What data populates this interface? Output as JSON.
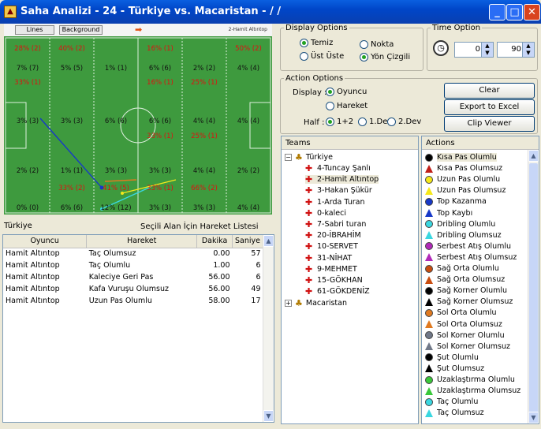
{
  "window": {
    "title": "Saha Analizi - 24 - Türkiye vs. Macaristan -  / /",
    "icon": "app-icon"
  },
  "colors": {
    "pitch": "#3e9a3e",
    "red_zone_text": "#e01010",
    "accent": "#0046c8"
  },
  "pitch": {
    "lines_label": "Lines",
    "background_label": "Background",
    "player_caption": "2-Hamit Altıntop",
    "zones": [
      [
        "28% (2)",
        "40% (2)",
        "",
        "16% (1)",
        "",
        "50% (2)"
      ],
      [
        "7% (7)",
        "5% (5)",
        "1% (1)",
        "6% (6)",
        "2% (2)",
        "4% (4)"
      ],
      [
        "33% (1)",
        "",
        "",
        "16% (1)",
        "25% (1)",
        ""
      ],
      [
        "3% (3)",
        "3% (3)",
        "6% (6)",
        "6% (6)",
        "4% (4)",
        "4% (4)"
      ],
      [
        "",
        "",
        "",
        "33% (1)",
        "25% (1)",
        ""
      ],
      [
        "2% (2)",
        "1% (1)",
        "3% (3)",
        "3% (3)",
        "4% (4)",
        "2% (2)"
      ],
      [
        "",
        "33% (2)",
        "41% (5)",
        "33% (1)",
        "66% (2)",
        ""
      ],
      [
        "0% (0)",
        "6% (6)",
        "12% (12)",
        "3% (3)",
        "3% (3)",
        "4% (4)"
      ]
    ],
    "red_rows": [
      0,
      2,
      4,
      6
    ]
  },
  "list": {
    "team": "Türkiye",
    "heading": "Seçili Alan İçin Hareket Listesi",
    "columns": [
      "Oyuncu",
      "Hareket",
      "Dakika",
      "Saniye"
    ],
    "rows": [
      [
        "Hamit Altıntop",
        "Taç Olumsuz",
        "0.00",
        "57"
      ],
      [
        "Hamit Altıntop",
        "Taç Olumlu",
        "1.00",
        "6"
      ],
      [
        "Hamit Altıntop",
        "Kaleciye Geri Pas",
        "56.00",
        "6"
      ],
      [
        "Hamit Altıntop",
        "Kafa Vuruşu Olumsuz",
        "56.00",
        "49"
      ],
      [
        "Hamit Altıntop",
        "Uzun Pas Olumlu",
        "58.00",
        "17"
      ]
    ]
  },
  "display_options": {
    "legend": "Display Options",
    "temiz": "Temiz",
    "nokta": "Nokta",
    "ust_uste": "Üst Üste",
    "yon_cizgili": "Yön Çizgili"
  },
  "time_option": {
    "legend": "Time Option",
    "from": "0",
    "to": "90"
  },
  "action_options": {
    "legend": "Action Options",
    "display_label": "Display :",
    "oyuncu": "Oyuncu",
    "hareket": "Hareket",
    "half_label": "Half :",
    "half1": "1+2",
    "half2": "1.Dev",
    "half3": "2.Dev",
    "clear": "Clear",
    "export": "Export to Excel",
    "clip": "Clip Viewer"
  },
  "teams": {
    "header": "Teams",
    "team1": "Türkiye",
    "team2": "Macaristan",
    "players": [
      "4-Tuncay Şanlı",
      "2-Hamit Altıntop",
      "3-Hakan Şükür",
      "1-Arda Turan",
      "0-kaleci",
      "7-Sabri turan",
      "20-İBRAHİM",
      "10-SERVET",
      "31-NİHAT",
      "9-MEHMET",
      "15-GÖKHAN",
      "61-GÖKDENİZ"
    ]
  },
  "actions": {
    "header": "Actions",
    "items": [
      {
        "label": "Kısa Pas Olumlu",
        "shape": "circle",
        "color": "#000000"
      },
      {
        "label": "Kısa Pas Olumsuz",
        "shape": "tri",
        "color": "#c0201a"
      },
      {
        "label": "Uzun Pas Olumlu",
        "shape": "circle",
        "color": "#f5e81a"
      },
      {
        "label": "Uzun Pas Olumsuz",
        "shape": "tri",
        "color": "#f5e81a"
      },
      {
        "label": "Top Kazanma",
        "shape": "circle",
        "color": "#1638c8"
      },
      {
        "label": "Top Kaybı",
        "shape": "tri",
        "color": "#1638c8"
      },
      {
        "label": "Dribling Olumlu",
        "shape": "circle",
        "color": "#3ad7e0"
      },
      {
        "label": "Dribling Olumsuz",
        "shape": "tri",
        "color": "#3ad7e0"
      },
      {
        "label": "Serbest Atış Olumlu",
        "shape": "circle",
        "color": "#b02ab8"
      },
      {
        "label": "Serbest Atış Olumsuz",
        "shape": "tri",
        "color": "#b02ab8"
      },
      {
        "label": "Sağ Orta Olumlu",
        "shape": "circle",
        "color": "#c84d10"
      },
      {
        "label": "Sağ Orta Olumsuz",
        "shape": "tri",
        "color": "#c84d10"
      },
      {
        "label": "Sağ Korner Olumlu",
        "shape": "circle",
        "color": "#000000"
      },
      {
        "label": "Sağ Korner Olumsuz",
        "shape": "tri",
        "color": "#000000"
      },
      {
        "label": "Sol Orta Olumlu",
        "shape": "circle",
        "color": "#e07a20"
      },
      {
        "label": "Sol Orta Olumsuz",
        "shape": "tri",
        "color": "#e07a20"
      },
      {
        "label": "Sol Korner Olumlu",
        "shape": "circle",
        "color": "#707888"
      },
      {
        "label": "Sol Korner Olumsuz",
        "shape": "tri",
        "color": "#707888"
      },
      {
        "label": "Şut Olumlu",
        "shape": "circle",
        "color": "#000000"
      },
      {
        "label": "Şut Olumsuz",
        "shape": "tri",
        "color": "#000000"
      },
      {
        "label": "Uzaklaştırma Olumlu",
        "shape": "circle",
        "color": "#3ac83a"
      },
      {
        "label": "Uzaklaştırma Olumsuz",
        "shape": "tri",
        "color": "#3ac83a"
      },
      {
        "label": "Taç Olumlu",
        "shape": "circle",
        "color": "#3ad7e0"
      },
      {
        "label": "Taç Olumsuz",
        "shape": "tri",
        "color": "#3ad7e0"
      }
    ]
  }
}
